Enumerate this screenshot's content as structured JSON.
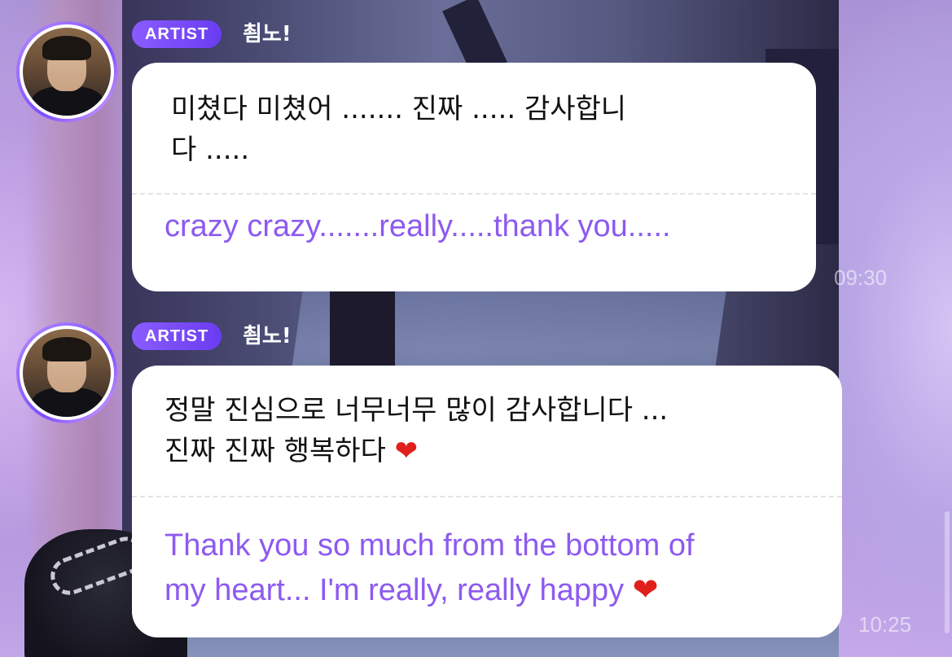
{
  "messages": [
    {
      "badge": "ARTIST",
      "name": "쵬노!",
      "original_line1": "미쳤다 미쳤어 ....... 진짜 ..... 감사합니",
      "original_line2": "다 .....",
      "translation_line1": "crazy crazy.......really.....thank you.....",
      "time": "09:30"
    },
    {
      "badge": "ARTIST",
      "name": "쵬노!",
      "original_line1": "정말 진심으로 너무너무 많이 감사합니다 ...",
      "original_line2": "진짜 진짜 행복하다",
      "original_emoji": "❤",
      "translation_line1": "Thank you so much from the bottom of",
      "translation_line2": "my heart... I'm really, really happy",
      "translation_emoji": "❤",
      "time": "10:25"
    }
  ],
  "icons": {
    "heart": "heart-emoji-icon"
  },
  "colors": {
    "badge": "#7a4cf6",
    "translation_text": "#8d5af0",
    "heart": "#e0201c"
  }
}
